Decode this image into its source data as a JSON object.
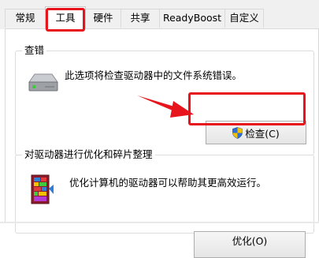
{
  "tabs": [
    {
      "label": "常规",
      "active": false
    },
    {
      "label": "工具",
      "active": true
    },
    {
      "label": "硬件",
      "active": false
    },
    {
      "label": "共享",
      "active": false
    },
    {
      "label": "ReadyBoost",
      "active": false
    },
    {
      "label": "自定义",
      "active": false
    }
  ],
  "error_check": {
    "title": "查错",
    "description": "此选项将检查驱动器中的文件系统错误。",
    "button_label": "检查(C)"
  },
  "optimize": {
    "title": "对驱动器进行优化和碎片整理",
    "description": "优化计算机的驱动器可以帮助其更高效运行。",
    "button_label": "优化(O)"
  },
  "colors": {
    "highlight": "#e8141b",
    "shield_blue": "#2f6fd4",
    "shield_yellow": "#f2c200"
  }
}
